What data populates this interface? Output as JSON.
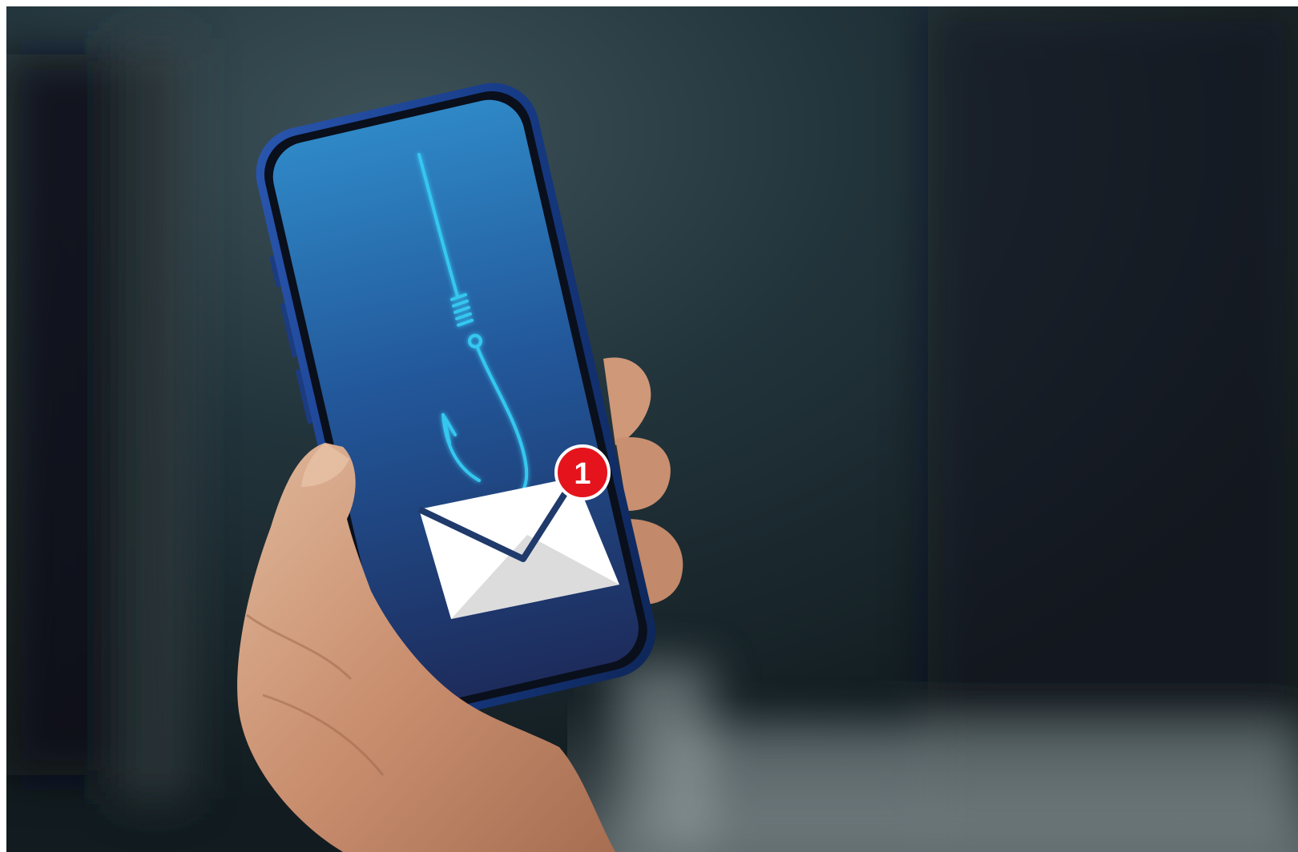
{
  "scene": {
    "description_free": true,
    "notification_badge": {
      "count": "1",
      "color": "#e5141c"
    },
    "colors": {
      "background": "#1c2a30",
      "screen_top": "#2f88c6",
      "screen_bottom": "#1d2c5c",
      "fishing_line": "#35c7f0",
      "phone_frame": "#1c3f8a",
      "envelope": "#ffffff"
    },
    "icons": [
      "fishing-hook-icon",
      "envelope-icon",
      "notification-badge-icon"
    ]
  }
}
